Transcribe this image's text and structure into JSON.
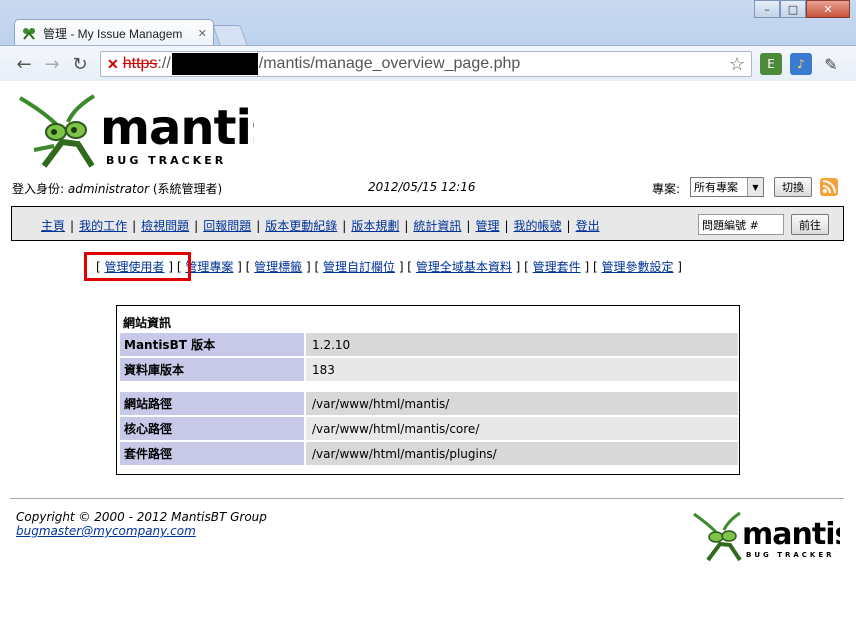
{
  "browser": {
    "tab_title": "管理 - My Issue Managem",
    "tab_close": "✕",
    "url_scheme": "https",
    "url_sep": "://",
    "url_path": "/mantis/manage_overview_page.php",
    "win_min": "–",
    "win_max": "□",
    "win_close": "✕",
    "icons": [
      "back-icon",
      "forward-icon",
      "reload-icon",
      "insecure-lock-icon",
      "bookmark-star-icon",
      "evernote-icon",
      "speaker-icon",
      "wrench-icon"
    ]
  },
  "logo": {
    "word": "mantis",
    "sub": "BUG TRACKER"
  },
  "login": {
    "label": "登入身份: ",
    "user": "administrator",
    "role": " (系統管理者)",
    "date": "2012/05/15 12:16",
    "project_label": "專案:",
    "project_value": "所有專案",
    "switch_label": "切換"
  },
  "menu": {
    "items": [
      "主頁",
      "我的工作",
      "檢視問題",
      "回報問題",
      "版本更動紀錄",
      "版本規劃",
      "統計資訊",
      "管理",
      "我的帳號",
      "登出"
    ],
    "issue_placeholder": "問題編號 #",
    "go_label": "前往"
  },
  "submenu": {
    "items": [
      "管理使用者",
      "管理專案",
      "管理標籤",
      "管理自訂欄位",
      "管理全域基本資料",
      "管理套件",
      "管理參數設定"
    ]
  },
  "info": {
    "title": "網站資訊",
    "rows": [
      {
        "label": "MantisBT 版本",
        "value": "1.2.10"
      },
      {
        "label": "資料庫版本",
        "value": "183"
      },
      {
        "label": "網站路徑",
        "value": "/var/www/html/mantis/"
      },
      {
        "label": "核心路徑",
        "value": "/var/www/html/mantis/core/"
      },
      {
        "label": "套件路徑",
        "value": "/var/www/html/mantis/plugins/"
      }
    ]
  },
  "footer": {
    "copyright": "Copyright © 2000 - 2012 MantisBT Group",
    "email": "bugmaster@mycompany.com"
  },
  "colors": {
    "link": "#003399",
    "label_bg": "#c8c8e8",
    "highlight": "#e00000",
    "logo_green": "#1f4d1a"
  }
}
